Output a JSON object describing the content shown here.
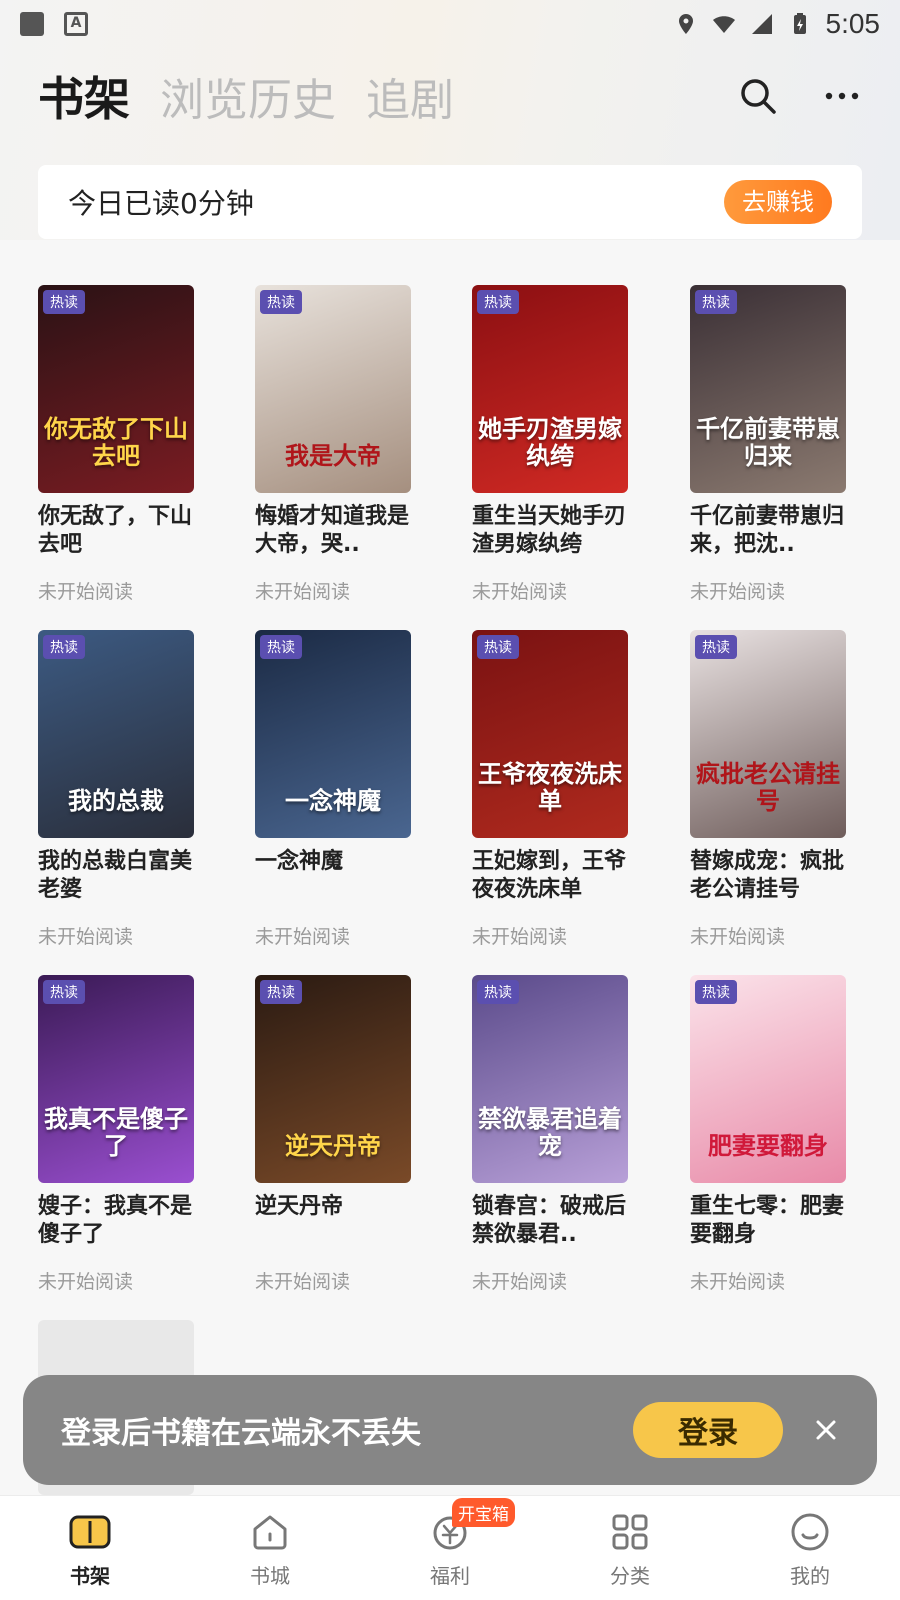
{
  "status_bar": {
    "time": "5:05"
  },
  "header": {
    "tabs": [
      {
        "label": "书架",
        "active": true
      },
      {
        "label": "浏览历史",
        "active": false
      },
      {
        "label": "追剧",
        "active": false
      }
    ],
    "search_icon": "search-icon",
    "more_icon": "more-icon"
  },
  "reading_banner": {
    "text": "今日已读0分钟",
    "button": "去赚钱"
  },
  "books": [
    {
      "title": "你无敌了，下山去吧",
      "cover_text": "你无敌了下山去吧",
      "badge": "热读",
      "status": "未开始阅读",
      "colors": [
        "#2a1215",
        "#7a1c22"
      ]
    },
    {
      "title": "悔婚才知道我是大帝，哭..",
      "cover_text": "我是大帝",
      "badge": "热读",
      "status": "未开始阅读",
      "colors": [
        "#e8e2dc",
        "#a58f7f"
      ]
    },
    {
      "title": "重生当天她手刃渣男嫁纨绔",
      "cover_text": "她手刃渣男嫁纨绔",
      "badge": "热读",
      "status": "未开始阅读",
      "colors": [
        "#8b0f12",
        "#d12a24"
      ]
    },
    {
      "title": "千亿前妻带崽归来，把沈..",
      "cover_text": "千亿前妻带崽归来",
      "badge": "热读",
      "status": "未开始阅读",
      "colors": [
        "#3a2f35",
        "#8b7a70"
      ]
    },
    {
      "title": "我的总裁白富美老婆",
      "cover_text": "我的总裁",
      "badge": "热读",
      "status": "未开始阅读",
      "colors": [
        "#3c5a82",
        "#2a2e3a"
      ]
    },
    {
      "title": "一念神魔",
      "cover_text": "一念神魔",
      "badge": "热读",
      "status": "未开始阅读",
      "colors": [
        "#1b2a44",
        "#4a6690"
      ]
    },
    {
      "title": "王妃嫁到，王爷夜夜洗床单",
      "cover_text": "王爷夜夜洗床单",
      "badge": "热读",
      "status": "未开始阅读",
      "colors": [
        "#7a1212",
        "#b02a1e"
      ]
    },
    {
      "title": "替嫁成宠：疯批老公请挂号",
      "cover_text": "疯批老公请挂号",
      "badge": "热读",
      "status": "未开始阅读",
      "colors": [
        "#e9e2e2",
        "#6e5c5a"
      ]
    },
    {
      "title": "嫂子：我真不是傻子了",
      "cover_text": "我真不是傻子了",
      "badge": "热读",
      "status": "未开始阅读",
      "colors": [
        "#3a1a55",
        "#9a4fd0"
      ]
    },
    {
      "title": "逆天丹帝",
      "cover_text": "逆天丹帝",
      "badge": "热读",
      "status": "未开始阅读",
      "colors": [
        "#2a1a12",
        "#7a4a28"
      ]
    },
    {
      "title": "锁春宫：破戒后禁欲暴君..",
      "cover_text": "禁欲暴君追着宠",
      "badge": "热读",
      "status": "未开始阅读",
      "colors": [
        "#5a4a8a",
        "#b8a0d8"
      ]
    },
    {
      "title": "重生七零：肥妻要翻身",
      "cover_text": "肥妻要翻身",
      "badge": "热读",
      "status": "未开始阅读",
      "colors": [
        "#fbe3ea",
        "#e88aa8"
      ]
    }
  ],
  "login_toast": {
    "text": "登录后书籍在云端永不丢失",
    "button": "登录",
    "close_icon": "close-icon"
  },
  "bottom_nav": {
    "items": [
      {
        "label": "书架",
        "icon": "bookshelf-icon",
        "active": true
      },
      {
        "label": "书城",
        "icon": "home-icon",
        "active": false
      },
      {
        "label": "福利",
        "icon": "welfare-icon",
        "active": false,
        "badge": "开宝箱"
      },
      {
        "label": "分类",
        "icon": "category-icon",
        "active": false
      },
      {
        "label": "我的",
        "icon": "profile-icon",
        "active": false
      }
    ]
  }
}
